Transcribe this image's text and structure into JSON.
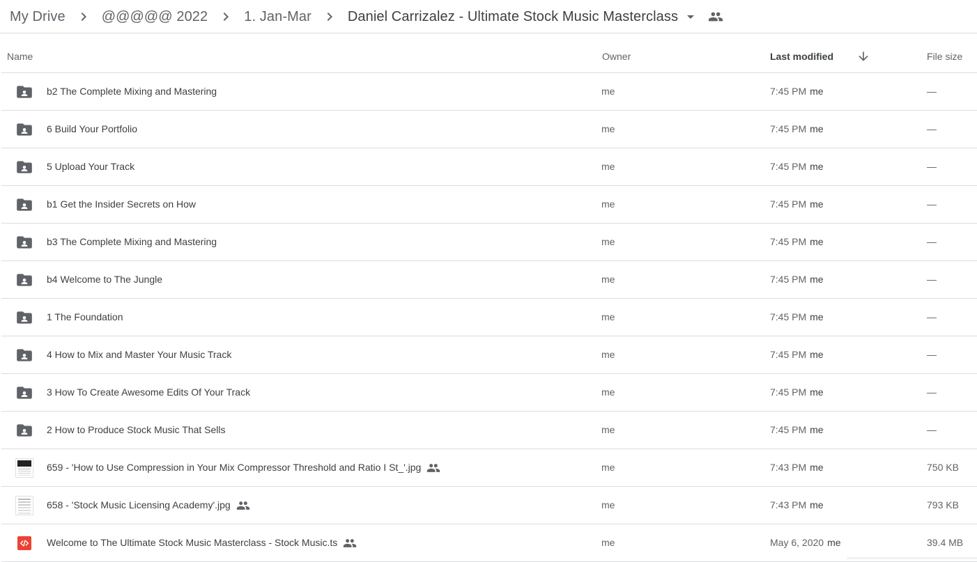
{
  "breadcrumb": {
    "items": [
      {
        "label": "My Drive"
      },
      {
        "label": "@@@@@ 2022"
      },
      {
        "label": "1. Jan-Mar"
      },
      {
        "label": "Daniel Carrizalez - Ultimate Stock Music Masterclass"
      }
    ],
    "dropdown_icon": "arrow-drop-down-icon",
    "shared_icon": "people-icon"
  },
  "table": {
    "headers": {
      "name": "Name",
      "owner": "Owner",
      "last_modified": "Last modified",
      "file_size": "File size",
      "sort_icon": "arrow-downward-icon"
    },
    "rows": [
      {
        "type": "folder",
        "icon": "shared-folder-icon",
        "name": "b2 The Complete Mixing and Mastering",
        "shared": false,
        "owner": "me",
        "modified": "7:45 PM",
        "modified_by": "me",
        "size": "—"
      },
      {
        "type": "folder",
        "icon": "shared-folder-icon",
        "name": "6 Build Your Portfolio",
        "shared": false,
        "owner": "me",
        "modified": "7:45 PM",
        "modified_by": "me",
        "size": "—"
      },
      {
        "type": "folder",
        "icon": "shared-folder-icon",
        "name": "5 Upload Your Track",
        "shared": false,
        "owner": "me",
        "modified": "7:45 PM",
        "modified_by": "me",
        "size": "—"
      },
      {
        "type": "folder",
        "icon": "shared-folder-icon",
        "name": "b1 Get the Insider Secrets on How",
        "shared": false,
        "owner": "me",
        "modified": "7:45 PM",
        "modified_by": "me",
        "size": "—"
      },
      {
        "type": "folder",
        "icon": "shared-folder-icon",
        "name": "b3 The Complete Mixing and Mastering",
        "shared": false,
        "owner": "me",
        "modified": "7:45 PM",
        "modified_by": "me",
        "size": "—"
      },
      {
        "type": "folder",
        "icon": "shared-folder-icon",
        "name": "b4 Welcome to The Jungle",
        "shared": false,
        "owner": "me",
        "modified": "7:45 PM",
        "modified_by": "me",
        "size": "—"
      },
      {
        "type": "folder",
        "icon": "shared-folder-icon",
        "name": "1 The Foundation",
        "shared": false,
        "owner": "me",
        "modified": "7:45 PM",
        "modified_by": "me",
        "size": "—"
      },
      {
        "type": "folder",
        "icon": "shared-folder-icon",
        "name": "4 How to Mix and Master Your Music Track",
        "shared": false,
        "owner": "me",
        "modified": "7:45 PM",
        "modified_by": "me",
        "size": "—"
      },
      {
        "type": "folder",
        "icon": "shared-folder-icon",
        "name": "3 How To Create Awesome Edits Of Your Track",
        "shared": false,
        "owner": "me",
        "modified": "7:45 PM",
        "modified_by": "me",
        "size": "—"
      },
      {
        "type": "folder",
        "icon": "shared-folder-icon",
        "name": "2 How to Produce Stock Music That Sells",
        "shared": false,
        "owner": "me",
        "modified": "7:45 PM",
        "modified_by": "me",
        "size": "—"
      },
      {
        "type": "image-dark",
        "icon": "image-thumbnail-icon",
        "name": "659 - 'How to Use Compression in Your Mix Compressor Threshold and Ratio I St_'.jpg",
        "shared": true,
        "owner": "me",
        "modified": "7:43 PM",
        "modified_by": "me",
        "size": "750 KB"
      },
      {
        "type": "image-light",
        "icon": "image-thumbnail-icon",
        "name": "658 - 'Stock Music Licensing Academy'.jpg",
        "shared": true,
        "owner": "me",
        "modified": "7:43 PM",
        "modified_by": "me",
        "size": "793 KB"
      },
      {
        "type": "code",
        "icon": "code-file-icon",
        "name": "Welcome to The Ultimate Stock Music Masterclass - Stock Music.ts",
        "shared": true,
        "owner": "me",
        "modified": "May 6, 2020",
        "modified_by": "me",
        "size": "39.4 MB"
      }
    ]
  },
  "colors": {
    "icon_gray": "#5f6368",
    "divider": "#dadce0",
    "code_icon_red": "#ea4335",
    "text_primary": "#3c4043",
    "text_secondary": "#5f6368"
  }
}
